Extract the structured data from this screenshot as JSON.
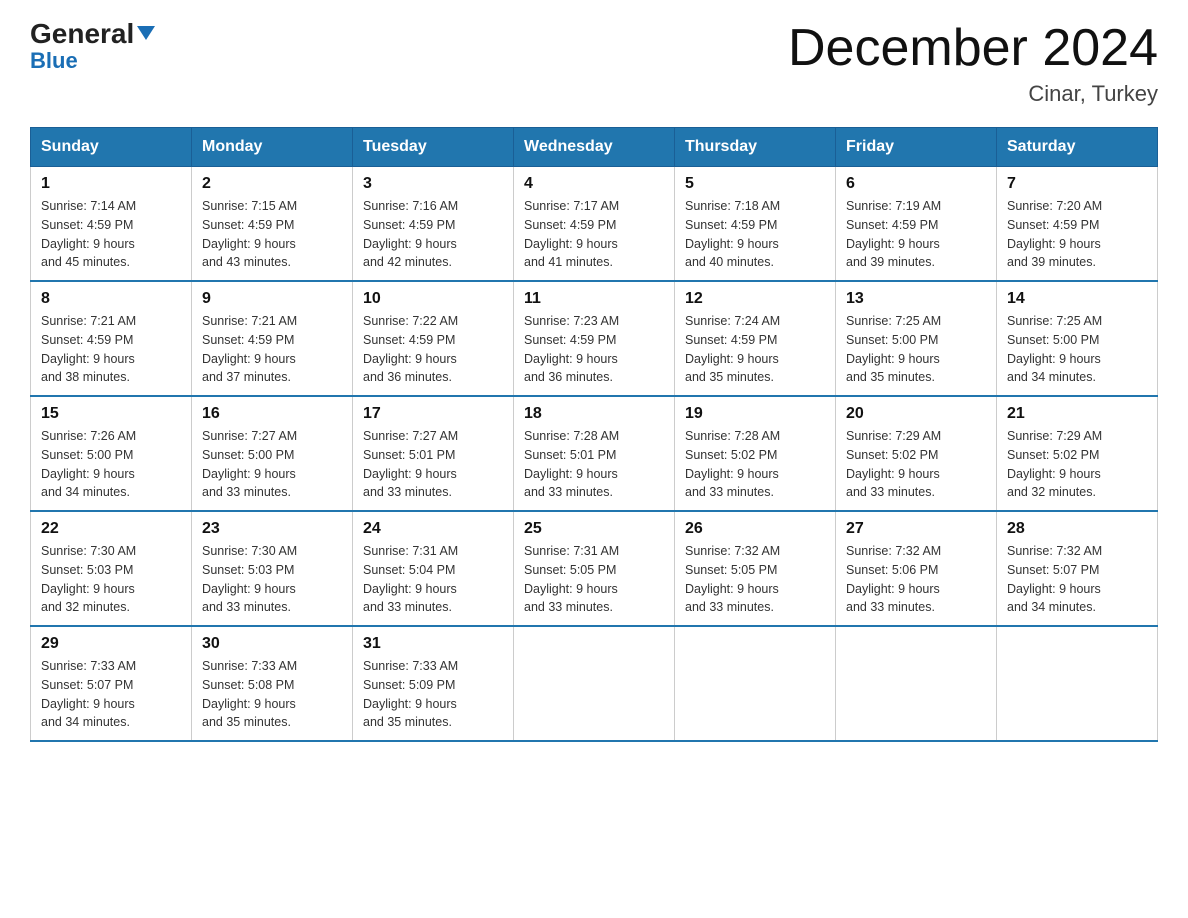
{
  "logo": {
    "general": "General",
    "blue": "Blue",
    "triangle": "▼"
  },
  "title": "December 2024",
  "location": "Cinar, Turkey",
  "days_of_week": [
    "Sunday",
    "Monday",
    "Tuesday",
    "Wednesday",
    "Thursday",
    "Friday",
    "Saturday"
  ],
  "weeks": [
    [
      {
        "day": "1",
        "sunrise": "7:14 AM",
        "sunset": "4:59 PM",
        "daylight": "9 hours and 45 minutes."
      },
      {
        "day": "2",
        "sunrise": "7:15 AM",
        "sunset": "4:59 PM",
        "daylight": "9 hours and 43 minutes."
      },
      {
        "day": "3",
        "sunrise": "7:16 AM",
        "sunset": "4:59 PM",
        "daylight": "9 hours and 42 minutes."
      },
      {
        "day": "4",
        "sunrise": "7:17 AM",
        "sunset": "4:59 PM",
        "daylight": "9 hours and 41 minutes."
      },
      {
        "day": "5",
        "sunrise": "7:18 AM",
        "sunset": "4:59 PM",
        "daylight": "9 hours and 40 minutes."
      },
      {
        "day": "6",
        "sunrise": "7:19 AM",
        "sunset": "4:59 PM",
        "daylight": "9 hours and 39 minutes."
      },
      {
        "day": "7",
        "sunrise": "7:20 AM",
        "sunset": "4:59 PM",
        "daylight": "9 hours and 39 minutes."
      }
    ],
    [
      {
        "day": "8",
        "sunrise": "7:21 AM",
        "sunset": "4:59 PM",
        "daylight": "9 hours and 38 minutes."
      },
      {
        "day": "9",
        "sunrise": "7:21 AM",
        "sunset": "4:59 PM",
        "daylight": "9 hours and 37 minutes."
      },
      {
        "day": "10",
        "sunrise": "7:22 AM",
        "sunset": "4:59 PM",
        "daylight": "9 hours and 36 minutes."
      },
      {
        "day": "11",
        "sunrise": "7:23 AM",
        "sunset": "4:59 PM",
        "daylight": "9 hours and 36 minutes."
      },
      {
        "day": "12",
        "sunrise": "7:24 AM",
        "sunset": "4:59 PM",
        "daylight": "9 hours and 35 minutes."
      },
      {
        "day": "13",
        "sunrise": "7:25 AM",
        "sunset": "5:00 PM",
        "daylight": "9 hours and 35 minutes."
      },
      {
        "day": "14",
        "sunrise": "7:25 AM",
        "sunset": "5:00 PM",
        "daylight": "9 hours and 34 minutes."
      }
    ],
    [
      {
        "day": "15",
        "sunrise": "7:26 AM",
        "sunset": "5:00 PM",
        "daylight": "9 hours and 34 minutes."
      },
      {
        "day": "16",
        "sunrise": "7:27 AM",
        "sunset": "5:00 PM",
        "daylight": "9 hours and 33 minutes."
      },
      {
        "day": "17",
        "sunrise": "7:27 AM",
        "sunset": "5:01 PM",
        "daylight": "9 hours and 33 minutes."
      },
      {
        "day": "18",
        "sunrise": "7:28 AM",
        "sunset": "5:01 PM",
        "daylight": "9 hours and 33 minutes."
      },
      {
        "day": "19",
        "sunrise": "7:28 AM",
        "sunset": "5:02 PM",
        "daylight": "9 hours and 33 minutes."
      },
      {
        "day": "20",
        "sunrise": "7:29 AM",
        "sunset": "5:02 PM",
        "daylight": "9 hours and 33 minutes."
      },
      {
        "day": "21",
        "sunrise": "7:29 AM",
        "sunset": "5:02 PM",
        "daylight": "9 hours and 32 minutes."
      }
    ],
    [
      {
        "day": "22",
        "sunrise": "7:30 AM",
        "sunset": "5:03 PM",
        "daylight": "9 hours and 32 minutes."
      },
      {
        "day": "23",
        "sunrise": "7:30 AM",
        "sunset": "5:03 PM",
        "daylight": "9 hours and 33 minutes."
      },
      {
        "day": "24",
        "sunrise": "7:31 AM",
        "sunset": "5:04 PM",
        "daylight": "9 hours and 33 minutes."
      },
      {
        "day": "25",
        "sunrise": "7:31 AM",
        "sunset": "5:05 PM",
        "daylight": "9 hours and 33 minutes."
      },
      {
        "day": "26",
        "sunrise": "7:32 AM",
        "sunset": "5:05 PM",
        "daylight": "9 hours and 33 minutes."
      },
      {
        "day": "27",
        "sunrise": "7:32 AM",
        "sunset": "5:06 PM",
        "daylight": "9 hours and 33 minutes."
      },
      {
        "day": "28",
        "sunrise": "7:32 AM",
        "sunset": "5:07 PM",
        "daylight": "9 hours and 34 minutes."
      }
    ],
    [
      {
        "day": "29",
        "sunrise": "7:33 AM",
        "sunset": "5:07 PM",
        "daylight": "9 hours and 34 minutes."
      },
      {
        "day": "30",
        "sunrise": "7:33 AM",
        "sunset": "5:08 PM",
        "daylight": "9 hours and 35 minutes."
      },
      {
        "day": "31",
        "sunrise": "7:33 AM",
        "sunset": "5:09 PM",
        "daylight": "9 hours and 35 minutes."
      },
      null,
      null,
      null,
      null
    ]
  ]
}
